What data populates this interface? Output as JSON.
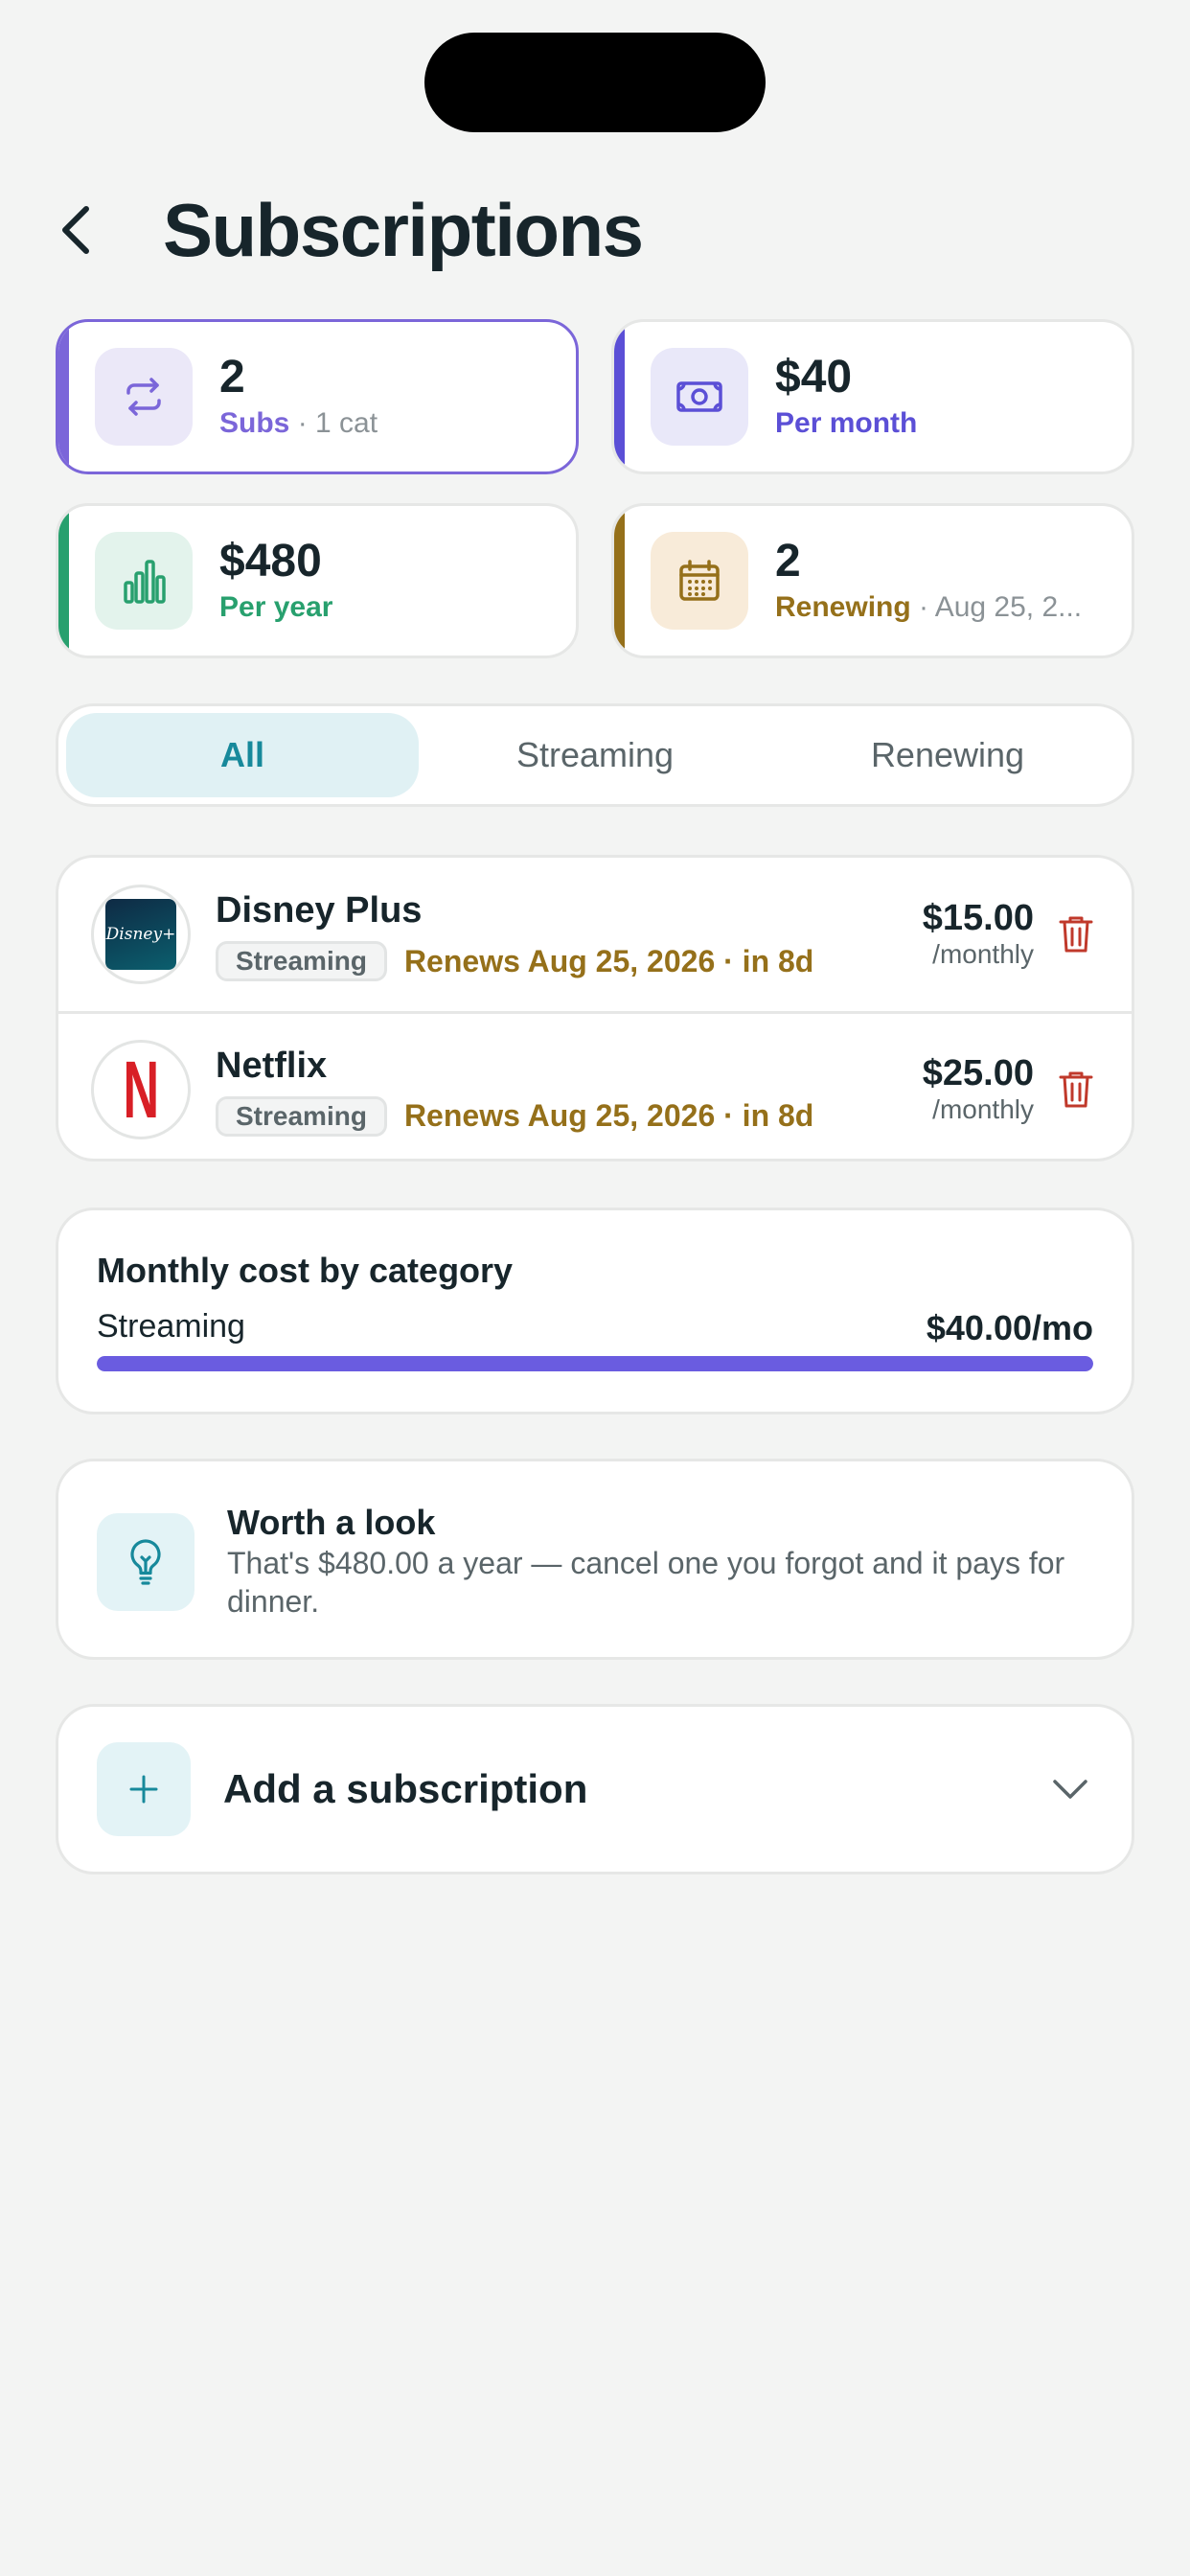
{
  "header": {
    "title": "Subscriptions"
  },
  "stats": [
    {
      "value": "2",
      "label": "Subs",
      "detail": "· 1 cat",
      "accent": "#7b66d9",
      "icon": "repeat-icon"
    },
    {
      "value": "$40",
      "label": "Per month",
      "detail": "",
      "accent": "#5b4fd6",
      "icon": "banknote-icon"
    },
    {
      "value": "$480",
      "label": "Per year",
      "detail": "",
      "accent": "#28a06e",
      "icon": "bar-chart-icon"
    },
    {
      "value": "2",
      "label": "Renewing",
      "detail": "· Aug 25, 2...",
      "accent": "#95701a",
      "icon": "calendar-icon"
    }
  ],
  "filters": {
    "tabs": [
      "All",
      "Streaming",
      "Renewing"
    ],
    "selected": "All"
  },
  "subscriptions": [
    {
      "name": "Disney Plus",
      "category": "Streaming",
      "renewal": "Renews Aug 25, 2026 · in 8d",
      "price": "$15.00",
      "period": "/monthly",
      "logo_text": "Disney+"
    },
    {
      "name": "Netflix",
      "category": "Streaming",
      "renewal": "Renews Aug 25, 2026 · in 8d",
      "price": "$25.00",
      "period": "/monthly",
      "logo_text": "N"
    }
  ],
  "cost_breakdown": {
    "title": "Monthly cost by category",
    "items": [
      {
        "label": "Streaming",
        "value": "$40.00/mo",
        "fraction": 1.0
      }
    ]
  },
  "tip": {
    "title": "Worth a look",
    "body": "That's $480.00 a year — cancel one you forgot and it pays for dinner."
  },
  "add": {
    "label": "Add a subscription"
  },
  "colors": {
    "primary_teal": "#17899b",
    "purple": "#7b66d9",
    "indigo": "#5b4fd6",
    "green": "#28a06e",
    "gold": "#95701a",
    "danger": "#c0392b",
    "netflix_red": "#d81f26"
  }
}
